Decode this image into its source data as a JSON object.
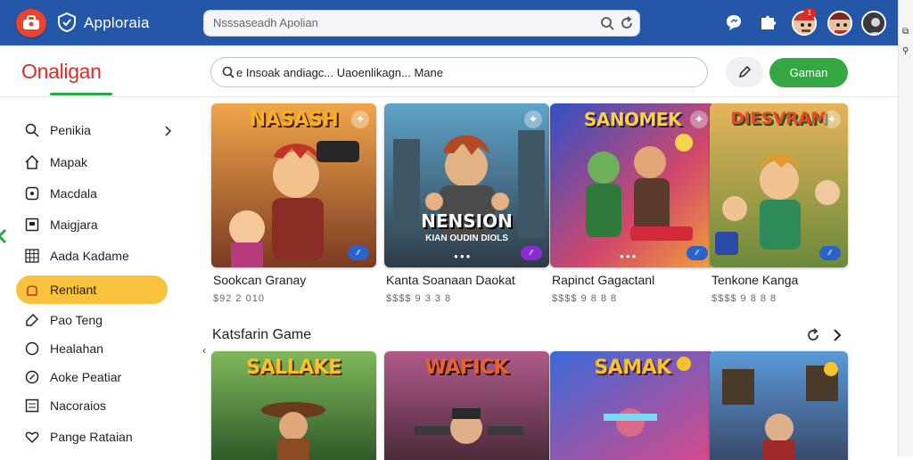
{
  "topbar": {
    "app_title": "Apploraia",
    "search_placeholder": "Nsssaseadh Apolian",
    "notification_count": "1"
  },
  "header": {
    "brand": "Onaligan",
    "search_value": "e Insoak andiagc... Uaoenlikagn... Mane",
    "primary_button": "Gaman"
  },
  "sidebar": {
    "items": [
      {
        "label": "Penikia",
        "icon": "search-icon"
      },
      {
        "label": "Mapak",
        "icon": "home-icon"
      },
      {
        "label": "Macdala",
        "icon": "badge-icon"
      },
      {
        "label": "Maigjara",
        "icon": "square-icon"
      },
      {
        "label": "Aada Kadame",
        "icon": "grid-icon"
      },
      {
        "label": "Rentiant",
        "icon": "shield-icon"
      },
      {
        "label": "Pao Teng",
        "icon": "tag-icon"
      },
      {
        "label": "Healahan",
        "icon": "circle-icon"
      },
      {
        "label": "Aoke Peatiar",
        "icon": "compass-icon"
      },
      {
        "label": "Nacoraios",
        "icon": "list-icon"
      },
      {
        "label": "Pange Rataian",
        "icon": "heart-icon"
      }
    ],
    "active_index": 5
  },
  "games_row1": [
    {
      "art_title": "NASASH",
      "title": "Sookcan Granay",
      "meta": "$92 2 010"
    },
    {
      "art_title": "NENSION",
      "art_subtitle": "KIAN OUDIN DIOLS",
      "title": "Kanta Soanaan Daokat",
      "meta": "$$$$ 9 3 3 8"
    },
    {
      "art_title": "SANOMEK",
      "title": "Rapinct Gagactanl",
      "meta": "$$$$ 9 8 8 8"
    },
    {
      "art_title": "DIESVRAM",
      "title": "Tenkone Kanga",
      "meta": "$$$$ 9 8 8 8"
    }
  ],
  "section": {
    "title": "Katsfarin Game"
  },
  "games_row2": [
    {
      "art_title": "SALLAKE"
    },
    {
      "art_title": "WAFICK"
    },
    {
      "art_title": "SAMAK"
    },
    {
      "art_title": ""
    }
  ],
  "colors": {
    "topbar": "#2557a8",
    "brand": "#e22a28",
    "accent_green": "#35a844",
    "active_item": "#f9c23c"
  }
}
